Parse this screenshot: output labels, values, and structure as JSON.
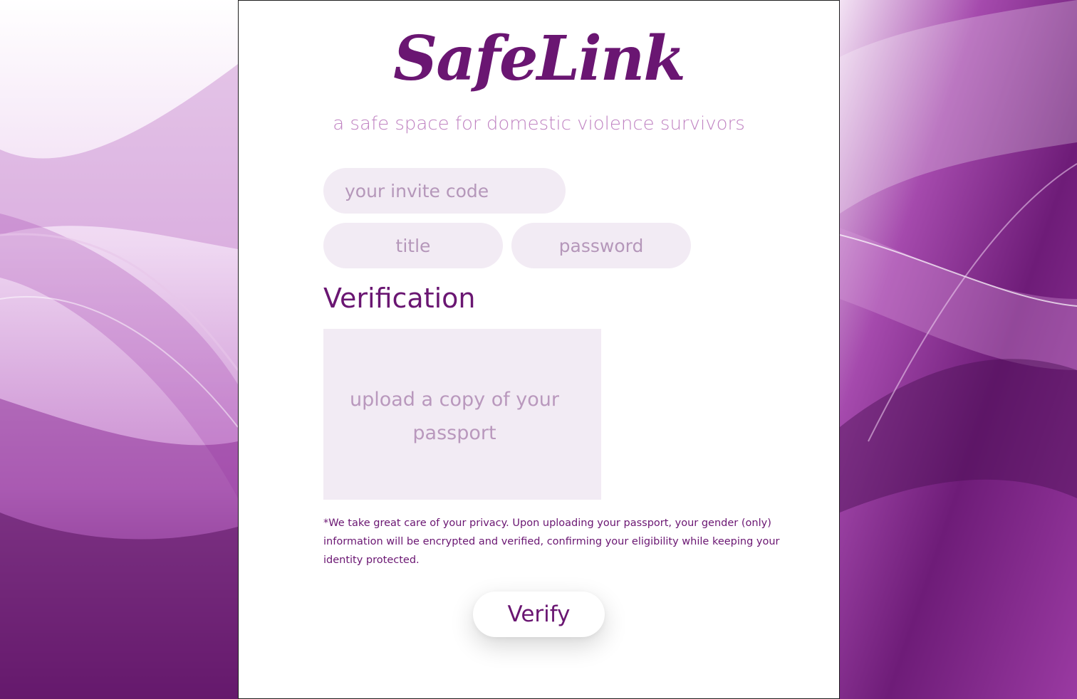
{
  "app": {
    "logo_text": "SafeLink",
    "tagline": "a safe space for domestic violence survivors"
  },
  "form": {
    "invite_code": {
      "placeholder": "your invite code",
      "value": ""
    },
    "title": {
      "placeholder": "title",
      "value": ""
    },
    "password": {
      "placeholder": "password",
      "value": ""
    },
    "verification_heading": "Verification",
    "upload_label": "upload a copy of your passport",
    "privacy_note": "*We take great care of your privacy. Upon uploading your passport, your gender (only) information will be encrypted and verified, confirming your eligibility while keeping your identity protected.",
    "verify_button": "Verify"
  },
  "colors": {
    "brand": "#6a1672",
    "muted": "#c083c2",
    "field_bg": "#f2ebf4"
  }
}
